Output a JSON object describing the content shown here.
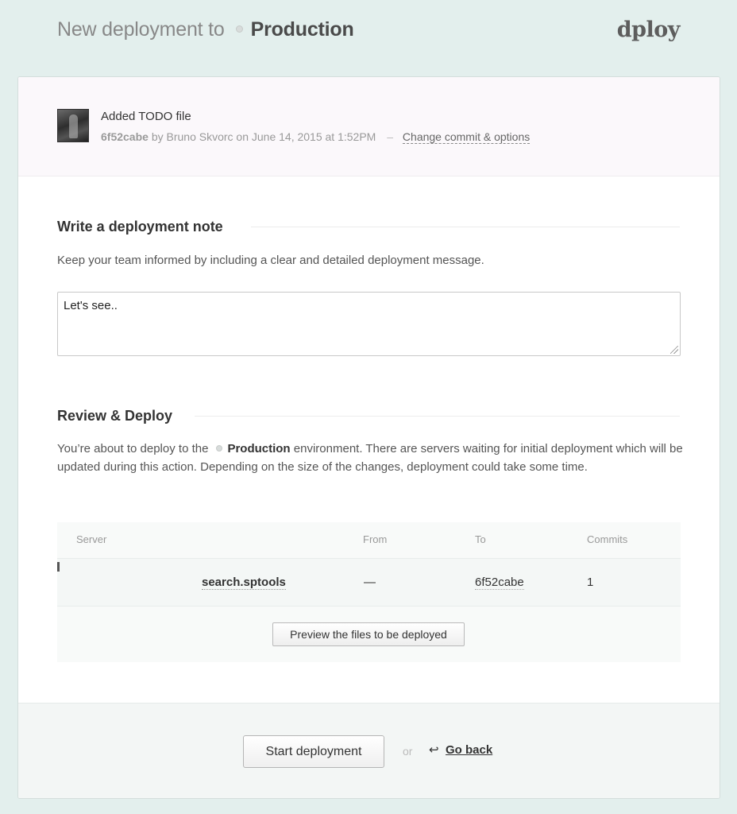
{
  "header": {
    "title_prefix": "New deployment to",
    "environment": "Production",
    "logo": "dploy"
  },
  "commit": {
    "message": "Added TODO file",
    "hash": "6f52cabe",
    "meta_text": "by Bruno Skvorc on June 14, 2015 at 1:52PM",
    "separator": "–",
    "change_link": "Change commit & options"
  },
  "note_section": {
    "title": "Write a deployment note",
    "description": "Keep your team informed by including a clear and detailed deployment message.",
    "textarea_value": "Let's see.."
  },
  "review_section": {
    "title": "Review & Deploy",
    "desc_before": "You’re about to deploy to the",
    "desc_env": "Production",
    "desc_after": "environment. There are servers waiting for initial deployment which will be updated during this action. Depending on the size of the changes, deployment could take some time."
  },
  "table": {
    "columns": [
      "Server",
      "From",
      "To",
      "Commits"
    ],
    "rows": [
      {
        "server": "search.sptools",
        "from": "—",
        "to": "6f52cabe",
        "commits": "1"
      }
    ],
    "preview_button": "Preview the files to be deployed"
  },
  "footer": {
    "start_button": "Start deployment",
    "or": "or",
    "back_arrow": "↩",
    "go_back": "Go back"
  },
  "colors": {
    "page_background": "#e3efed",
    "card_background": "#ffffff",
    "commit_bar_background": "#fbf8fb",
    "footer_background": "#f3f6f5"
  }
}
